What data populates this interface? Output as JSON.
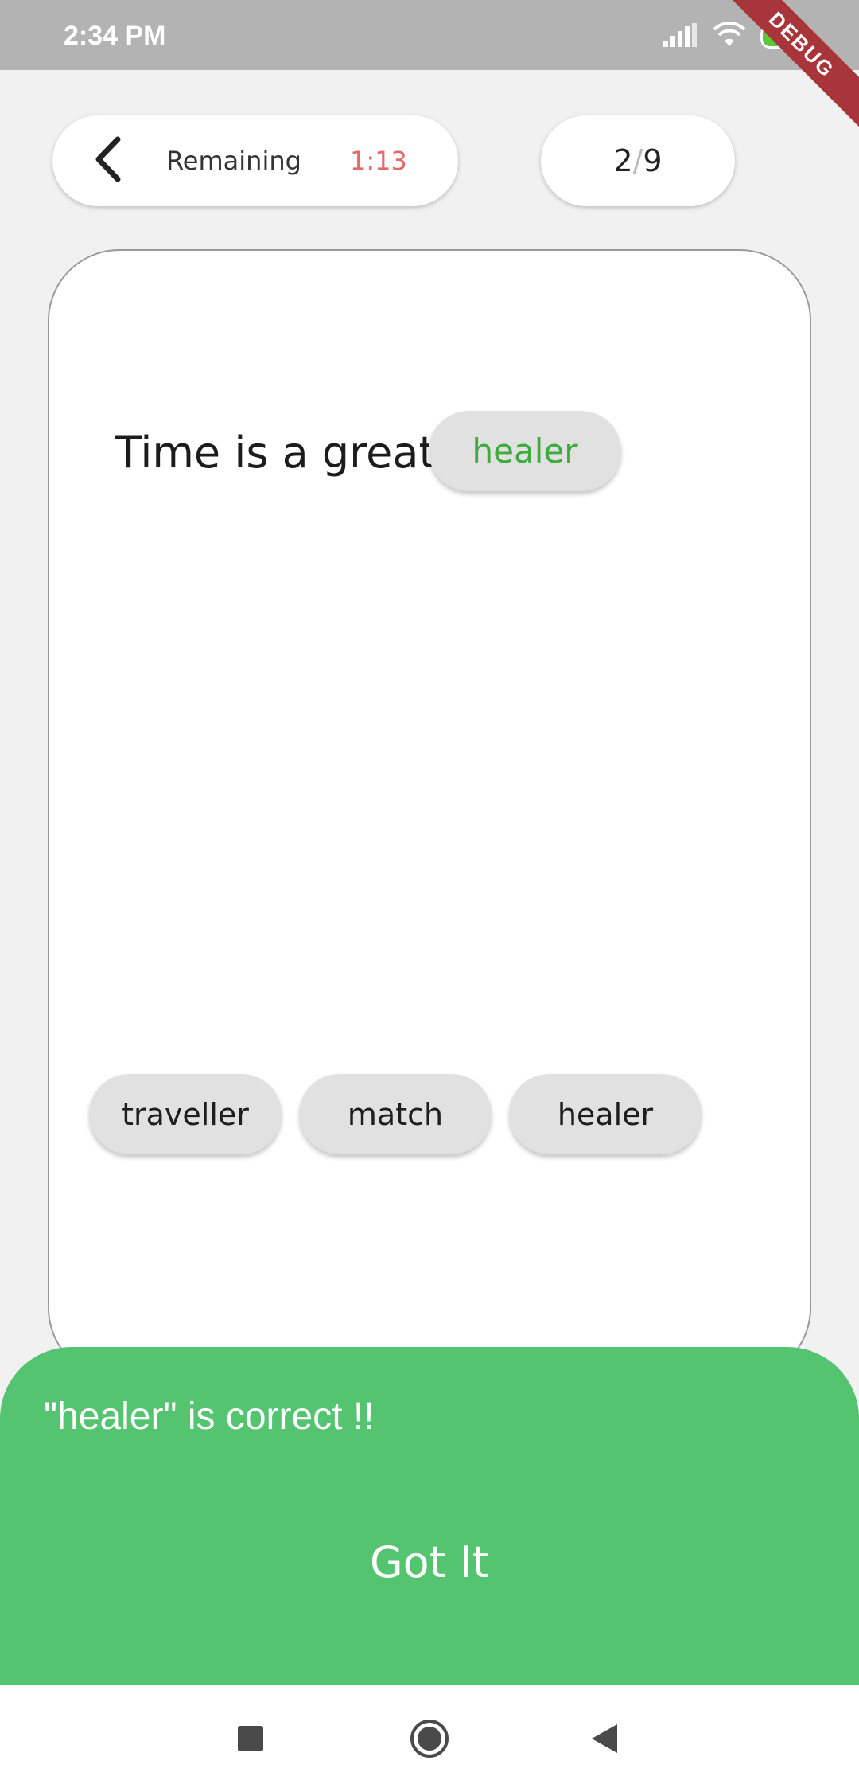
{
  "status_bar": {
    "time": "2:34 PM",
    "battery": "100",
    "debug_banner": "DEBUG"
  },
  "header": {
    "remaining_label": "Remaining",
    "timer": "1:13",
    "progress_current": "2",
    "progress_separator": "/",
    "progress_total": "9"
  },
  "question": {
    "sentence": "Time is a great",
    "answer": "healer"
  },
  "options": [
    "traveller",
    "match",
    "healer"
  ],
  "result": {
    "message": "\"healer\" is correct !!",
    "button_label": "Got It"
  },
  "colors": {
    "status_bar": "#b3b3b3",
    "timer": "#e26a6a",
    "correct_answer": "#3dab3d",
    "result_sheet": "#55c470",
    "chip": "#e1e1e1",
    "debug_banner": "#a8353a"
  },
  "icons": {
    "back": "chevron-left-icon",
    "signal": "signal-icon",
    "wifi": "wifi-icon",
    "battery": "battery-icon",
    "nav_recents": "square-icon",
    "nav_home": "circle-icon",
    "nav_back": "triangle-back-icon"
  }
}
